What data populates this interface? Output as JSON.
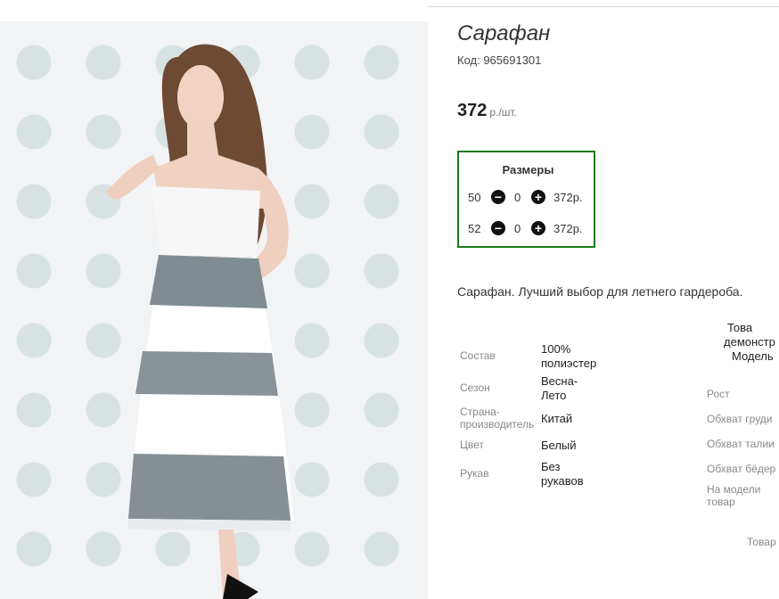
{
  "product": {
    "title": "Сарафан",
    "code": "Код: 965691301",
    "price": "372",
    "price_unit": "р./шт.",
    "description": "Сарафан. Лучший выбор для летнего гардероба."
  },
  "sizes": {
    "header": "Размеры",
    "rows": [
      {
        "size": "50",
        "qty": "0",
        "price": "372р."
      },
      {
        "size": "52",
        "qty": "0",
        "price": "372р."
      }
    ]
  },
  "specs": [
    {
      "label": "Состав",
      "value": "100% полиэстер"
    },
    {
      "label": "Сезон",
      "value": "Весна-Лето"
    },
    {
      "label": "Страна-производитель",
      "value": "Китай"
    },
    {
      "label": "Цвет",
      "value": "Белый"
    },
    {
      "label": "Рукав",
      "value": "Без рукавов"
    }
  ],
  "model": {
    "caption": [
      "Това",
      "демонстр",
      "Модель"
    ],
    "params": [
      "Рост",
      "Обхват груди",
      "Обхват талии",
      "Обхват бёдер",
      "На модели товар"
    ],
    "footer": "Товар"
  },
  "icons": {
    "minus": "minus-circle-icon",
    "plus": "plus-circle-icon"
  },
  "colors": {
    "sizes_border": "#1b7a1b"
  }
}
